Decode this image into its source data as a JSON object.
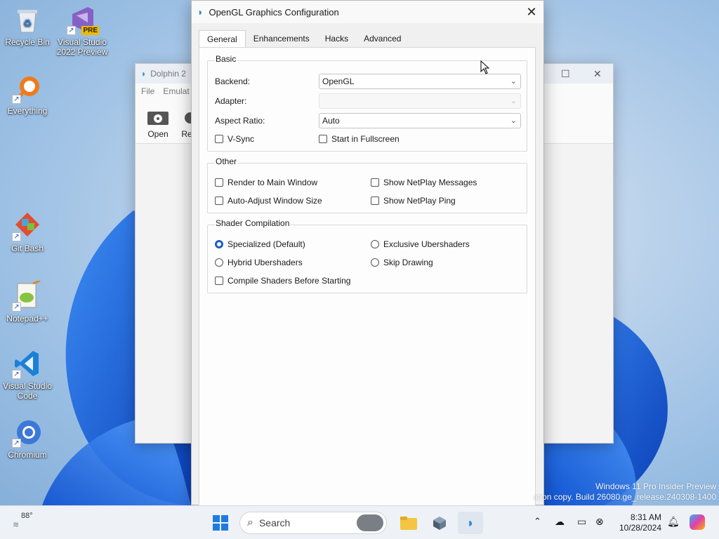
{
  "desktop": {
    "icons": [
      {
        "label": "Recycle Bin",
        "icon": "recycle-bin-icon"
      },
      {
        "label": "Visual Studio 2022 Preview",
        "icon": "visual-studio-icon",
        "badge": "PRE"
      },
      {
        "label": "Everything",
        "icon": "everything-search-icon"
      },
      {
        "label": "Git Bash",
        "icon": "git-bash-icon"
      },
      {
        "label": "Notepad++",
        "icon": "notepad-plus-plus-icon"
      },
      {
        "label": "Visual Studio Code",
        "icon": "vscode-icon"
      },
      {
        "label": "Chromium",
        "icon": "chromium-icon"
      }
    ],
    "watermark": {
      "line1": "Windows 11 Pro Insider Preview",
      "line2": "ation copy. Build 26080.ge_release.240308-1400"
    }
  },
  "dolphin_main": {
    "title": "Dolphin 2",
    "menu": [
      "File",
      "Emulat"
    ],
    "toolbar": [
      "Open",
      "Re"
    ]
  },
  "dialog": {
    "title": "OpenGL Graphics Configuration",
    "tabs": [
      "General",
      "Enhancements",
      "Hacks",
      "Advanced"
    ],
    "active_tab": "General",
    "basic": {
      "title": "Basic",
      "backend_label": "Backend:",
      "backend_value": "OpenGL",
      "adapter_label": "Adapter:",
      "adapter_value": "",
      "aspect_label": "Aspect Ratio:",
      "aspect_value": "Auto",
      "vsync": {
        "label": "V-Sync",
        "checked": false
      },
      "fullscreen": {
        "label": "Start in Fullscreen",
        "checked": false
      }
    },
    "other": {
      "title": "Other",
      "render_main": {
        "label": "Render to Main Window",
        "checked": false
      },
      "auto_adjust": {
        "label": "Auto-Adjust Window Size",
        "checked": false
      },
      "netplay_messages": {
        "label": "Show NetPlay Messages",
        "checked": false
      },
      "netplay_ping": {
        "label": "Show NetPlay Ping",
        "checked": false
      }
    },
    "shader": {
      "title": "Shader Compilation",
      "specialized": {
        "label": "Specialized (Default)",
        "selected": true
      },
      "hybrid": {
        "label": "Hybrid Ubershaders",
        "selected": false
      },
      "exclusive": {
        "label": "Exclusive Ubershaders",
        "selected": false
      },
      "skip": {
        "label": "Skip Drawing",
        "selected": false
      },
      "compile_before": {
        "label": "Compile Shaders Before Starting",
        "checked": false
      }
    }
  },
  "taskbar": {
    "weather_temp": "88°",
    "search_label": "Search",
    "time": "8:31 AM",
    "date": "10/28/2024",
    "accent": "#1f5fbf"
  }
}
